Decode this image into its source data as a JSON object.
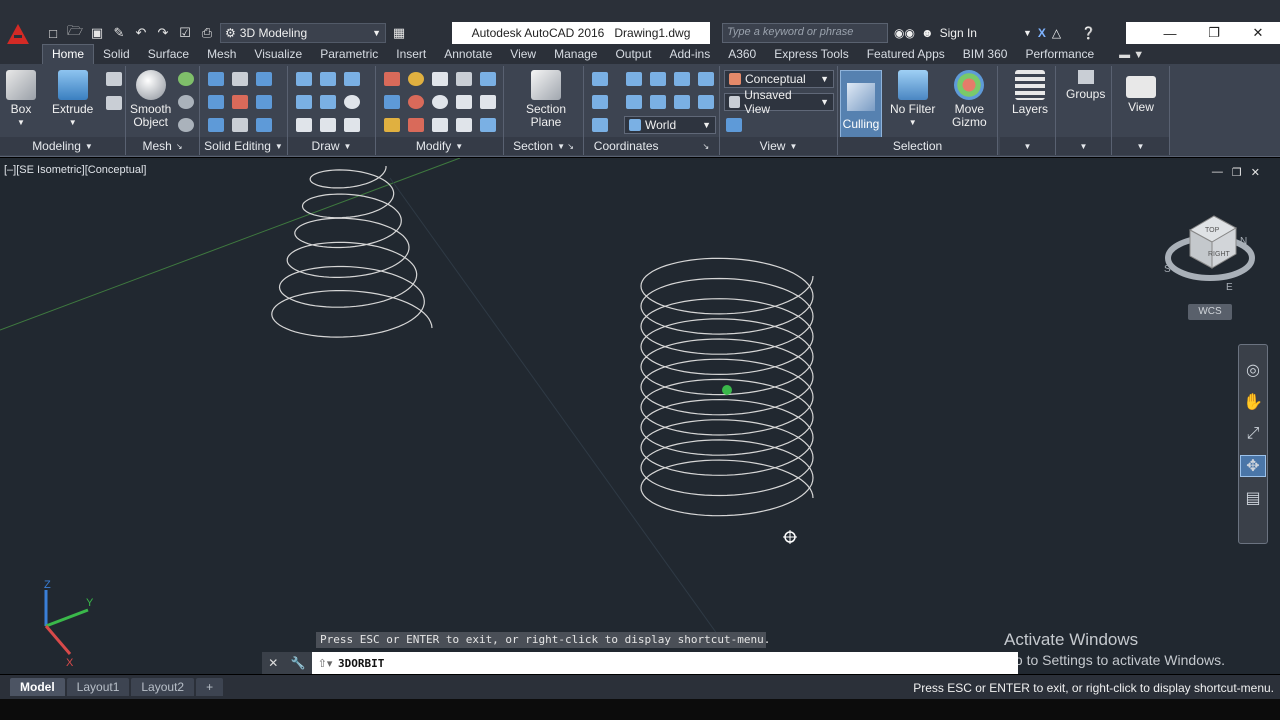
{
  "title_bar": {
    "workspace": "3D Modeling",
    "app_name": "Autodesk AutoCAD 2016",
    "document": "Drawing1.dwg",
    "search_placeholder": "Type a keyword or phrase",
    "sign_in": "Sign In"
  },
  "ribbon_tabs": [
    "Home",
    "Solid",
    "Surface",
    "Mesh",
    "Visualize",
    "Parametric",
    "Insert",
    "Annotate",
    "View",
    "Manage",
    "Output",
    "Add-ins",
    "A360",
    "Express Tools",
    "Featured Apps",
    "BIM 360",
    "Performance"
  ],
  "ribbon": {
    "panels": {
      "modeling": "Modeling",
      "mesh": "Mesh",
      "solid_editing": "Solid Editing",
      "draw": "Draw",
      "modify": "Modify",
      "section": "Section",
      "coordinates": "Coordinates",
      "view": "View",
      "selection": "Selection"
    },
    "buttons": {
      "box": "Box",
      "extrude": "Extrude",
      "smooth_object_1": "Smooth",
      "smooth_object_2": "Object",
      "section_plane_1": "Section",
      "section_plane_2": "Plane",
      "culling": "Culling",
      "no_filter": "No Filter",
      "move_gizmo_1": "Move",
      "move_gizmo_2": "Gizmo",
      "layers": "Layers",
      "groups": "Groups",
      "view": "View"
    },
    "dropdowns": {
      "visual_style": "Conceptual",
      "named_view": "Unsaved View",
      "ucs": "World"
    }
  },
  "viewport": {
    "label": "[–][SE Isometric][Conceptual]",
    "wcs": "WCS",
    "viewcube": {
      "top": "TOP",
      "right": "RIGHT",
      "n": "N",
      "e": "E",
      "s": "S"
    },
    "axis": {
      "x": "X",
      "y": "Y",
      "z": "Z"
    },
    "prompt_hint": "Press ESC or ENTER to exit, or right-click to display shortcut-menu.",
    "watermark_title": "Activate Windows",
    "watermark_sub": "Go to Settings to activate Windows."
  },
  "command_line": {
    "text": "3DORBIT"
  },
  "layout_tabs": [
    "Model",
    "Layout1",
    "Layout2"
  ],
  "status_message": "Press ESC or ENTER to exit, or right-click to display shortcut-menu.",
  "colors": {
    "accent": "#d42a25",
    "viewport_bg": "#212830",
    "ribbon_bg": "#3d4451",
    "selected": "#5681b0"
  }
}
